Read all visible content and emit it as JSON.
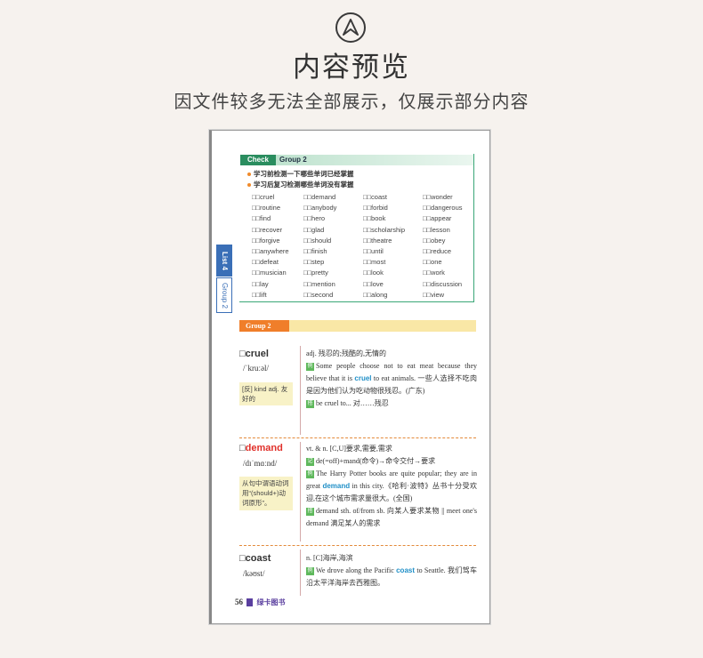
{
  "header": {
    "title": "内容预览",
    "subtitle": "因文件较多无法全部展示，仅展示部分内容"
  },
  "check_section": {
    "tag": "Check",
    "group": "Group 2",
    "notes": [
      "学习前检测一下哪些单词已经掌握",
      "学习后复习检测哪些单词没有掌握"
    ],
    "words": [
      "□□cruel",
      "□□demand",
      "□□coast",
      "□□wonder",
      "□□routine",
      "□□anybody",
      "□□forbid",
      "□□dangerous",
      "□□find",
      "□□hero",
      "□□book",
      "□□appear",
      "□□recover",
      "□□glad",
      "□□scholarship",
      "□□lesson",
      "□□forgive",
      "□□should",
      "□□theatre",
      "□□obey",
      "□□anywhere",
      "□□finish",
      "□□until",
      "□□reduce",
      "□□defeat",
      "□□step",
      "□□most",
      "□□one",
      "□□musician",
      "□□pretty",
      "□□look",
      "□□work",
      "□□lay",
      "□□mention",
      "□□love",
      "□□discussion",
      "□□lift",
      "□□second",
      "□□along",
      "□□view"
    ]
  },
  "side_tabs": {
    "list": "List 4",
    "group": "Group 2"
  },
  "group_heading": "Group 2",
  "entries": {
    "cruel": {
      "checkbox": "□",
      "word": "cruel",
      "phonetic": "/ˈkruːəl/",
      "note": "[反] kind adj. 友好的",
      "pos": "adj. 残忍的;残酷的,无情的",
      "ex_pre": "Some people choose not to eat meat because they believe that it is",
      "ex_hl": "cruel",
      "ex_post": "to eat animals. 一些人选择不吃肉是因为他们认为吃动物很残忍。(广东)",
      "phrase": "be cruel to... 对……残忍"
    },
    "demand": {
      "checkbox": "□",
      "word": "demand",
      "phonetic": "/dɪˈmɑːnd/",
      "note": "从句中谓语动词用“(should+)动词原形”。",
      "pos": "vt. & n. [C,U]要求,需要,需求",
      "memory": "de(=off)+mand(命令)→命令交付→要求",
      "ex_pre": "The Harry Potter books are quite popular; they are in great",
      "ex_hl": "demand",
      "ex_post": "in this city.《哈利·波特》丛书十分受欢迎,在这个城市需求量很大。(全国)",
      "phrase": "demand sth. of/from sb. 向某人要求某物 || meet one's demand 满足某人的需求"
    },
    "coast": {
      "checkbox": "□",
      "word": "coast",
      "phonetic": "/kəʊst/",
      "pos": "n. [C]海岸,海滨",
      "ex_pre": "We drove along the Pacific",
      "ex_hl": "coast",
      "ex_post": "to Seattle. 我们驾车沿太平洋海岸去西雅图。"
    }
  },
  "icons": {
    "example": "例",
    "phrase": "搭",
    "memory": "记"
  },
  "footer": {
    "page_number": "56",
    "brand": "绿卡图书"
  }
}
